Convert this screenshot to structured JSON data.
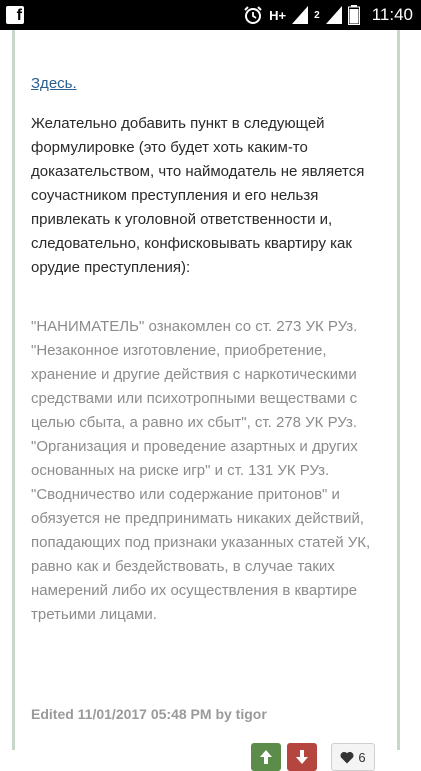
{
  "status_bar": {
    "time": "11:40",
    "network": "H+",
    "sim2": "2",
    "icons": [
      "facebook-icon",
      "alarm-icon",
      "signal-icon",
      "signal-icon",
      "battery-icon"
    ]
  },
  "post": {
    "link_text": "Здесь.",
    "paragraph": "Желательно добавить пункт в следующей формулировке (это будет хоть каким-то доказательством, что наймодатель не является соучастником преступления и его нельзя привлекать к уголовной ответственности и, следовательно, конфисковывать квартиру как орудие преступления):",
    "quote": "\"НАНИМАТЕЛЬ\" ознакомлен со ст. 273 УК РУз. \"Незаконное изготовление, приобретение, хранение и другие действия с наркотическими средствами или психотропными веществами с целью сбыта, а равно их сбыт\", ст. 278 УК РУз. \"Организация и проведение азартных и других основанных на риске игр\" и ст. 131 УК РУз. \"Сводничество или содержание притонов\" и обязуется не предпринимать никаких действий, попадающих под признаки указанных статей УК, равно как и бездействовать, в случае таких намерений либо их осуществления в квартире третьими лицами.",
    "edited": "Edited 11/01/2017 05:48 PM by tigor"
  },
  "actions": {
    "like_count": "6"
  },
  "colors": {
    "link": "#2b5f8f",
    "upvote": "#5c8c4a",
    "downvote": "#b5463f",
    "quote_text": "#8c8c8c"
  }
}
